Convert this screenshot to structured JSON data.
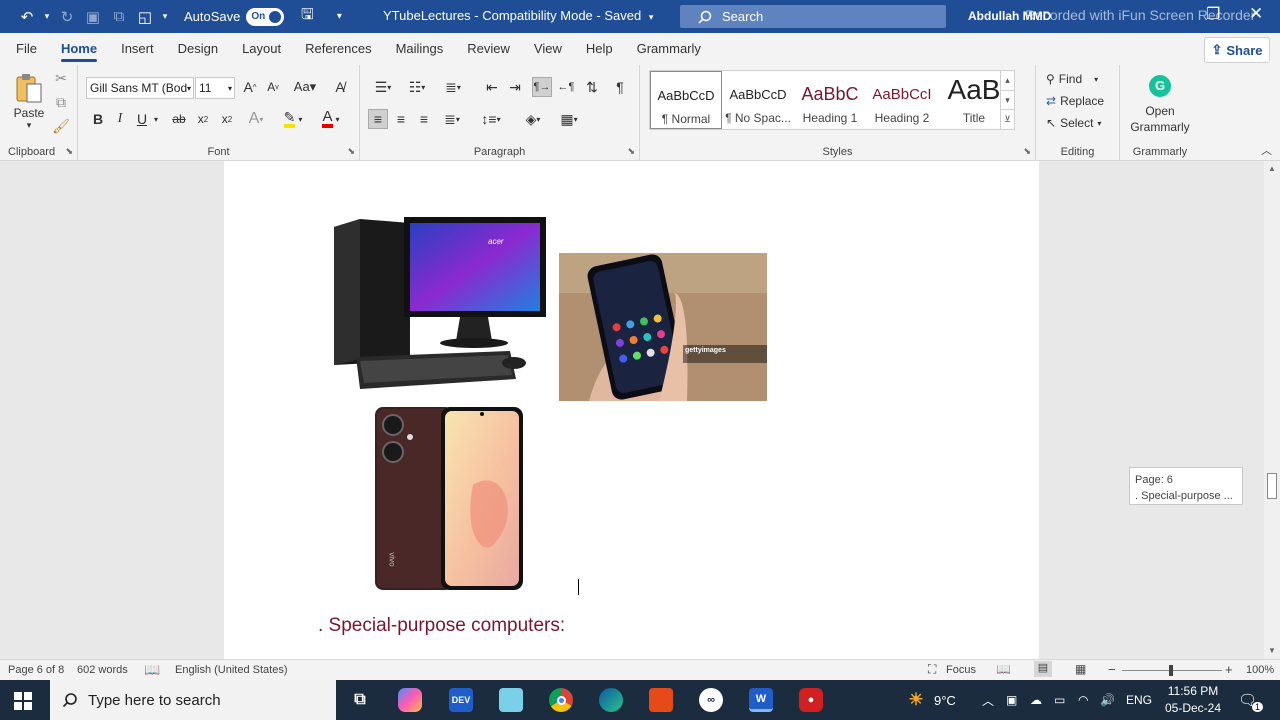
{
  "titlebar": {
    "autosave_label": "AutoSave",
    "autosave_state": "On",
    "doc_title": "YTubeLectures  -  Compatibility Mode  -  Saved",
    "search_placeholder": "Search",
    "user_name": "Abdullah MMD",
    "watermark": "Recorded with iFun Screen Recorder"
  },
  "menu": {
    "tabs": [
      "File",
      "Home",
      "Insert",
      "Design",
      "Layout",
      "References",
      "Mailings",
      "Review",
      "View",
      "Help",
      "Grammarly"
    ],
    "active": "Home",
    "share_label": "Share"
  },
  "ribbon": {
    "clipboard": {
      "label": "Clipboard",
      "paste_label": "Paste"
    },
    "font": {
      "label": "Font",
      "font_name": "Gill Sans MT (Bod",
      "font_size": "11"
    },
    "paragraph": {
      "label": "Paragraph"
    },
    "styles": {
      "label": "Styles",
      "items": [
        {
          "sample": "AaBbCcD",
          "name": "¶ Normal"
        },
        {
          "sample": "AaBbCcD",
          "name": "¶ No Spac..."
        },
        {
          "sample": "AaBbC",
          "name": "Heading 1"
        },
        {
          "sample": "AaBbCcI",
          "name": "Heading 2"
        },
        {
          "sample": "AaB",
          "name": "Title"
        }
      ]
    },
    "editing": {
      "label": "Editing",
      "find": "Find",
      "replace": "Replace",
      "select": "Select"
    },
    "grammarly": {
      "label": "Grammarly",
      "open_line1": "Open",
      "open_line2": "Grammarly"
    }
  },
  "document": {
    "heading": ". Special-purpose computers:",
    "image_watermark": "gettyimages",
    "phone_brand": "vivo",
    "monitor_brand": "acer"
  },
  "scroll_tooltip": {
    "line1": "Page: 6",
    "line2": ". Special-purpose ..."
  },
  "statusbar": {
    "page": "Page 6 of 8",
    "words": "602 words",
    "language": "English (United States)",
    "focus": "Focus",
    "zoom": "100%"
  },
  "taskbar": {
    "search_placeholder": "Type here to search",
    "weather": "9°C",
    "lang": "ENG",
    "time": "11:56 PM",
    "date": "05-Dec-24",
    "notification_count": "1"
  },
  "colors": {
    "titlebar": "#1f4e96",
    "heading": "#7b1630",
    "taskbar": "#1c2c3f"
  }
}
